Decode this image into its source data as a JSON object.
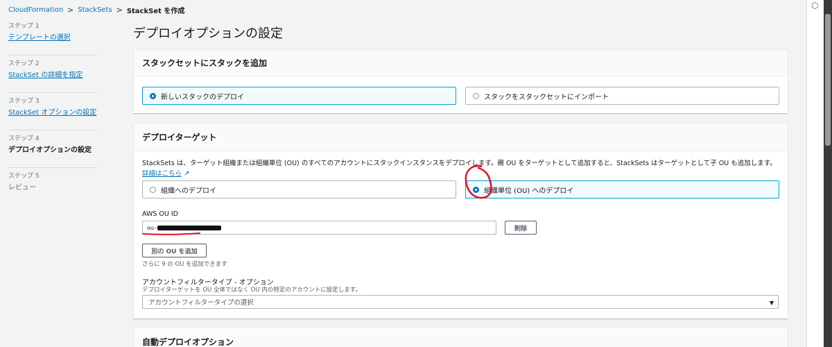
{
  "breadcrumb": {
    "items": [
      "CloudFormation",
      "StackSets"
    ],
    "current": "StackSet を作成",
    "separator": ">"
  },
  "sidebar": {
    "steps": [
      {
        "num": "ステップ 1",
        "name": "テンプレートの選択"
      },
      {
        "num": "ステップ 2",
        "name": "StackSet の詳細を指定"
      },
      {
        "num": "ステップ 3",
        "name": "StackSet オプションの設定"
      },
      {
        "num": "ステップ 4",
        "name": "デプロイオプションの設定"
      },
      {
        "num": "ステップ 5",
        "name": "レビュー"
      }
    ]
  },
  "page": {
    "title": "デプロイオプションの設定"
  },
  "add_stacks": {
    "heading": "スタックセットにスタックを追加",
    "options": [
      "新しいスタックのデプロイ",
      "スタックをスタックセットにインポート"
    ],
    "selected": 0
  },
  "targets": {
    "heading": "デプロイターゲット",
    "description": "StackSets は、ターゲット組織または組織単位 (OU) のすべてのアカウントにスタックインスタンスをデプロイします。親 OU をターゲットとして追加すると、StackSets はターゲットとして子 OU も追加します。",
    "learn_more": "詳細はこちら",
    "external_icon": "external-link-icon",
    "options": [
      "組織へのデプロイ",
      "組織単位 (OU) へのデプロイ"
    ],
    "selected": 1,
    "ou_label": "AWS OU ID",
    "ou_value_prefix": "ou-",
    "remove_button": "削除",
    "add_ou_button": "別の OU を追加",
    "add_ou_hint": "さらに 9 の OU を追加できます",
    "filter_label": "アカウントフィルタータイプ - オプション",
    "filter_desc": "デプロイターゲットを OU 全体ではなく OU 内の特定のアカウントに設定します。",
    "filter_placeholder": "アカウントフィルタータイプの選択",
    "caret_icon": "caret-down-icon"
  },
  "auto_deploy": {
    "heading": "自動デプロイオプション"
  },
  "colors": {
    "link": "#0073bb",
    "annotation": "#e0112b",
    "selected_border": "#00a1c9"
  }
}
